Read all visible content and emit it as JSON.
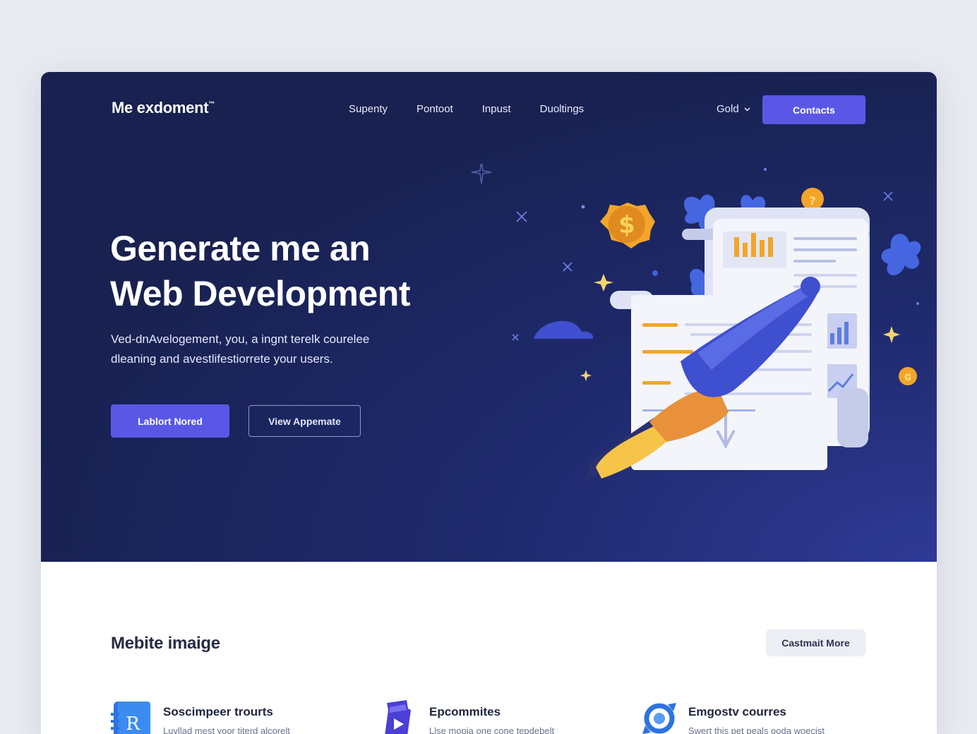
{
  "nav": {
    "logo": "Me exdoment",
    "logo_mark": "™",
    "links": [
      "Supenty",
      "Pontoot",
      "Inpust",
      "Duoltings"
    ],
    "language": "Gold",
    "contacts_button": "Contacts"
  },
  "hero": {
    "title_lines": [
      "Generate me an",
      "Web Development"
    ],
    "subtitle_lines": [
      "Ved-dnAvelogement, you, a ingnt terelk courelee",
      "dleaning and avestlifestiorrete your users."
    ],
    "primary_button": "Lablort Nored",
    "secondary_button": "View Appemate"
  },
  "section": {
    "title": "Mebite imaige",
    "more_button": "Castmait More"
  },
  "features": [
    {
      "title": "Soscimpeer trourts",
      "desc": "Luvllad mest yoor titerd alcorelt",
      "icon": "book-icon"
    },
    {
      "title": "Epcommites",
      "desc": "Llse mopia one cone tepdebelt",
      "icon": "video-icon"
    },
    {
      "title": "Emgostv courres",
      "desc": "Swert this pet peals ooda woecist",
      "icon": "refresh-icon"
    }
  ],
  "colors": {
    "hero_bg": "#1f2a6e",
    "accent": "#5b57e6",
    "gold": "#f2a52a"
  }
}
